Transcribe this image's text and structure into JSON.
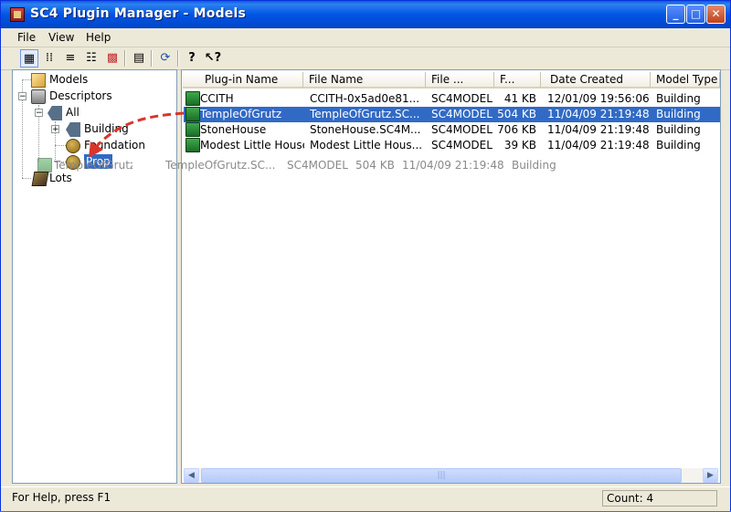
{
  "window": {
    "title": "SC4 Plugin Manager - Models",
    "min_label": "_",
    "max_label": "□",
    "close_label": "✕"
  },
  "menu": [
    "File",
    "View",
    "Help"
  ],
  "toolbar": {
    "icons": [
      "large-icons-view",
      "small-icons-view",
      "list-view",
      "details-view",
      "color-view",
      "properties",
      "refresh",
      "help",
      "context-help"
    ]
  },
  "tree": {
    "models": "Models",
    "descriptors": "Descriptors",
    "all": "All",
    "building": "Building",
    "foundation": "Foundation",
    "prop": "Prop",
    "lots": "Lots",
    "expand_minus": "−",
    "expand_plus": "+"
  },
  "columns": [
    "Plug-in Name",
    "File Name",
    "File ...",
    "F...",
    "Date Created",
    "Model Type"
  ],
  "rows": [
    {
      "name": "CCITH",
      "file": "CCITH-0x5ad0e81...",
      "type": "SC4MODEL",
      "size": "41 KB",
      "date": "12/01/09 19:56:06",
      "model": "Building",
      "selected": false
    },
    {
      "name": "TempleOfGrutz",
      "file": "TempleOfGrutz.SC...",
      "type": "SC4MODEL",
      "size": "504 KB",
      "date": "11/04/09 21:19:48",
      "model": "Building",
      "selected": true
    },
    {
      "name": "StoneHouse",
      "file": "StoneHouse.SC4M...",
      "type": "SC4MODEL",
      "size": "706 KB",
      "date": "11/04/09 21:19:48",
      "model": "Building",
      "selected": false
    },
    {
      "name": "Modest Little House",
      "file": "Modest Little Hous...",
      "type": "SC4MODEL",
      "size": "39 KB",
      "date": "11/04/09 21:19:48",
      "model": "Building",
      "selected": false
    }
  ],
  "drag_ghost": {
    "name": "TempleOfGrutz",
    "file": "TempleOfGrutz.SC...",
    "type": "SC4MODEL",
    "size": "504 KB",
    "date": "11/04/09 21:19:48",
    "model": "Building"
  },
  "scrollbar": {
    "left": "◀",
    "right": "▶",
    "grip": "|||"
  },
  "status": {
    "help": "For Help, press F1",
    "count": "Count: 4"
  },
  "colors": {
    "selection": "#316ac5",
    "titlebar": "#0055e5",
    "drag_arrow": "#d9352a"
  }
}
